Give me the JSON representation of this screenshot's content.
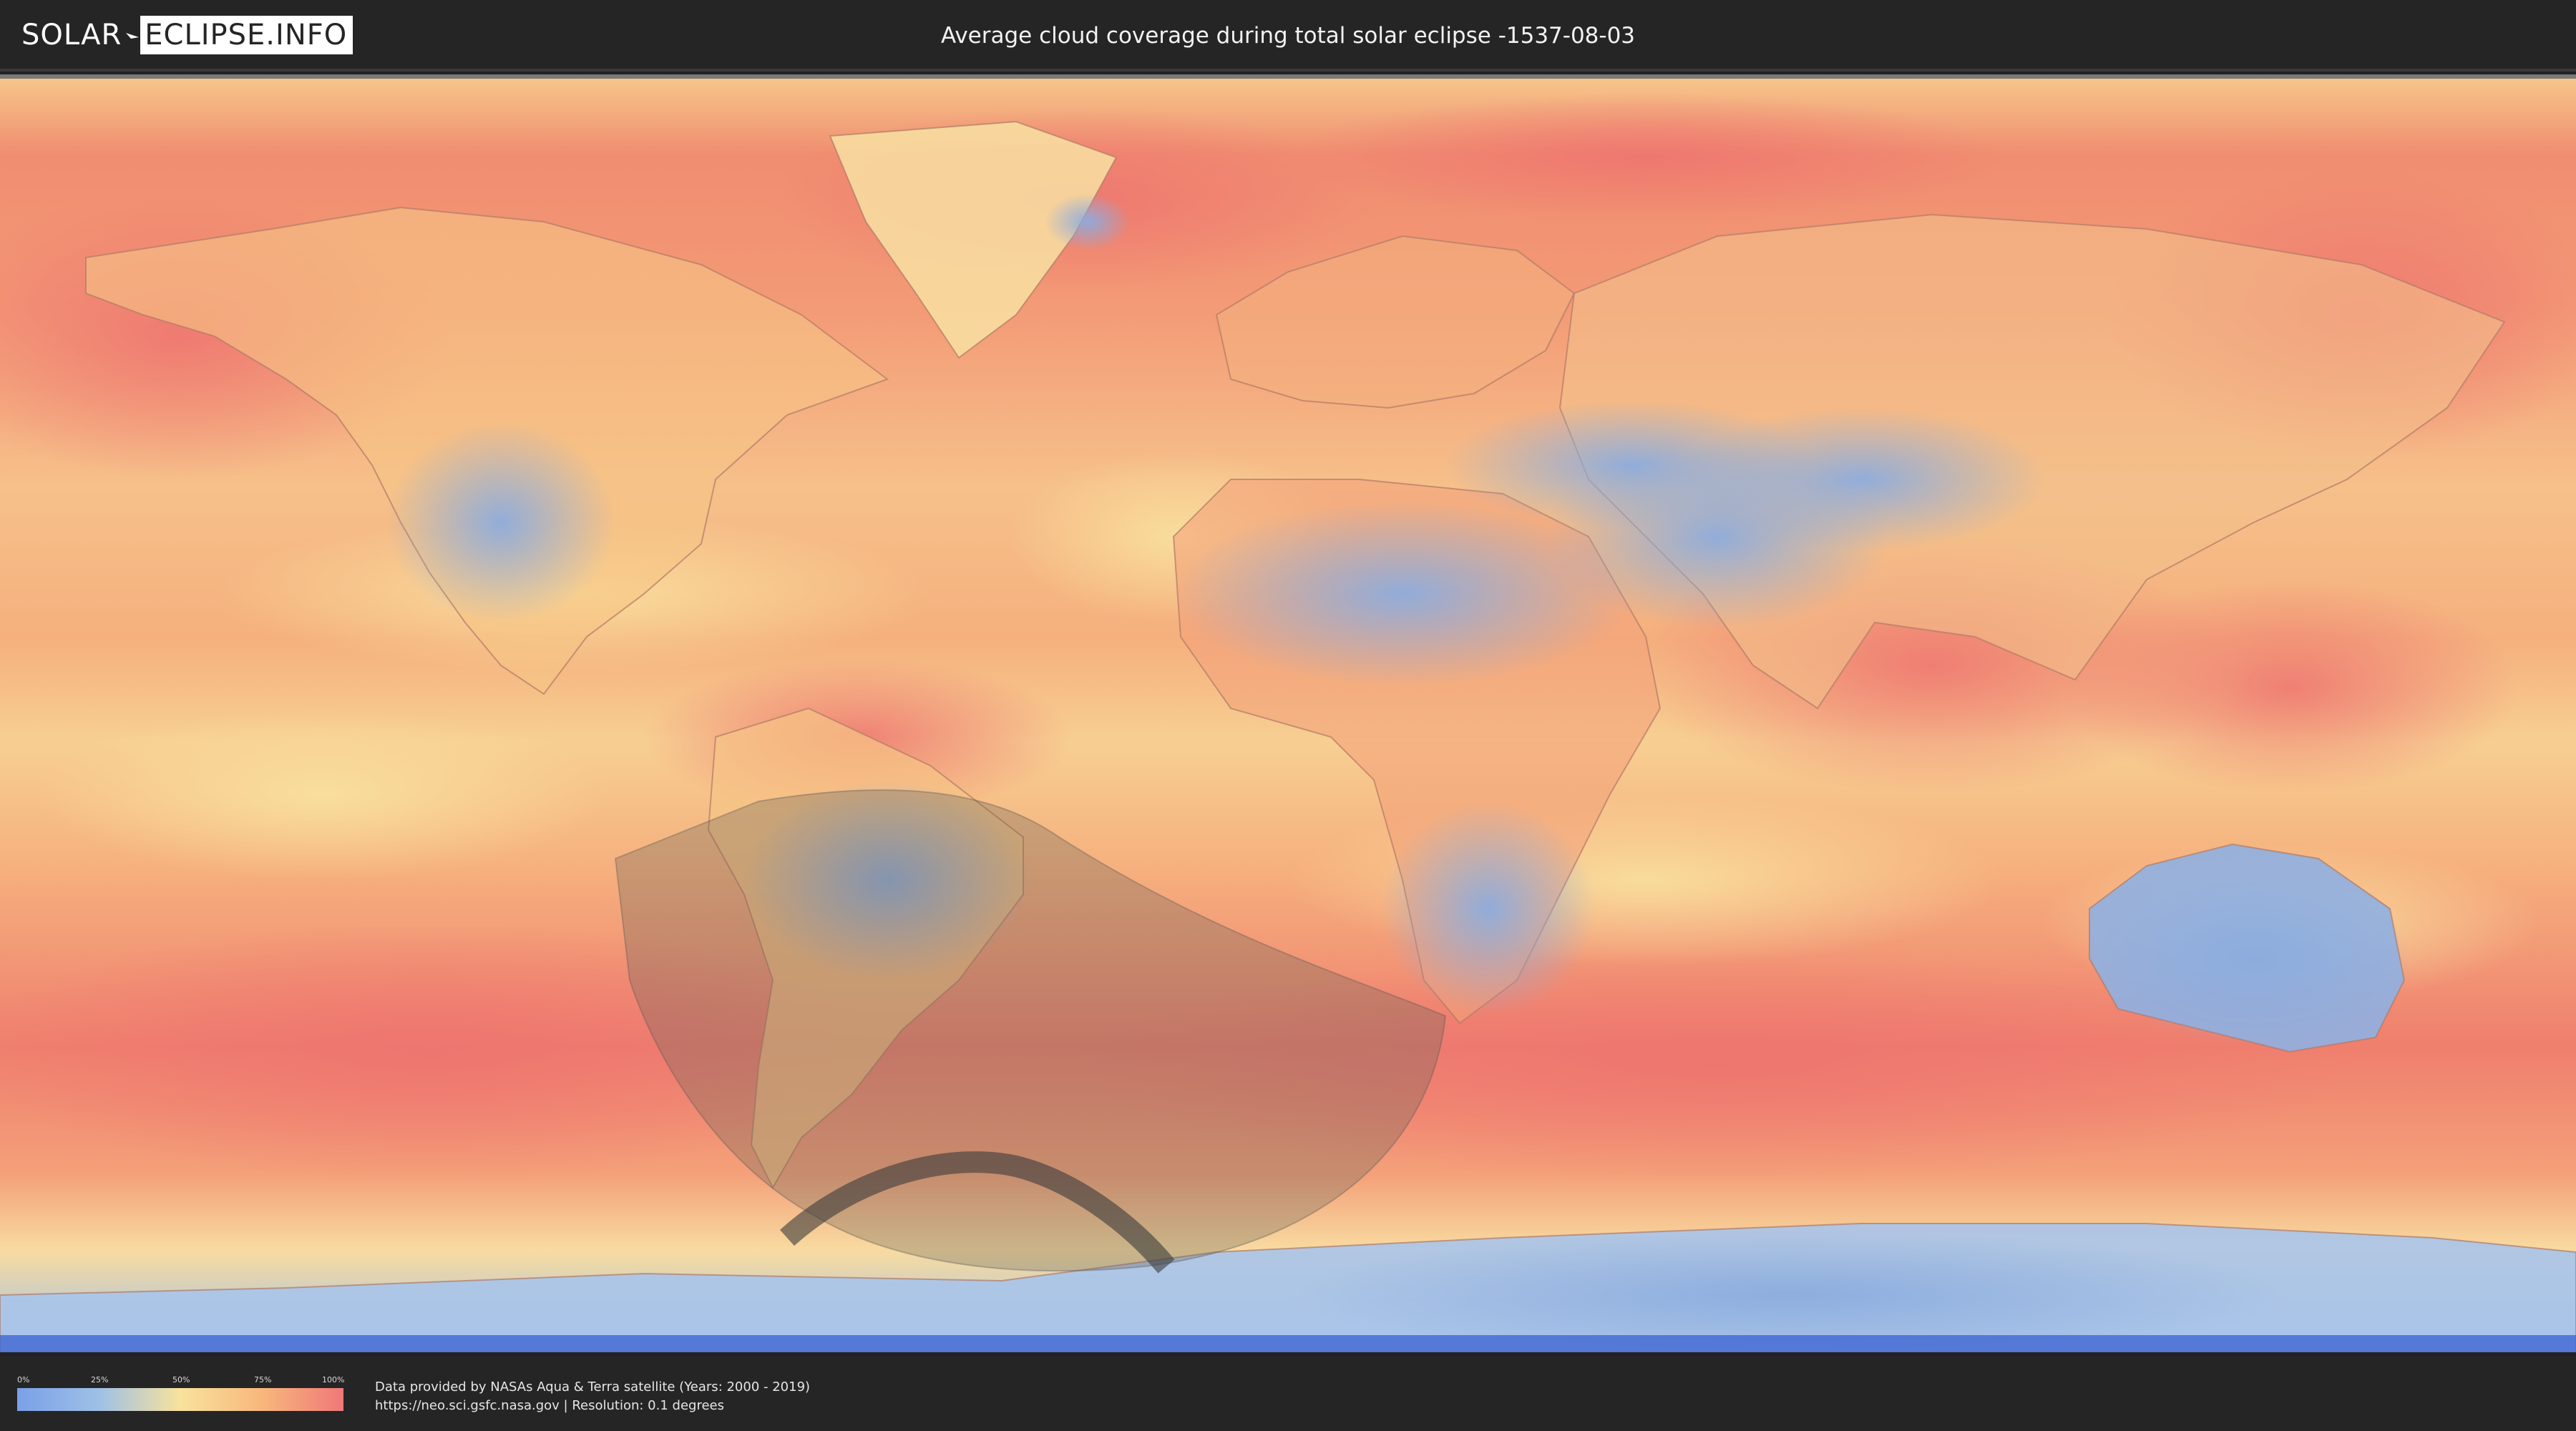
{
  "header": {
    "logo_part1": "SOLAR",
    "logo_part2": "ECLIPSE.INFO",
    "title": "Average cloud coverage during total solar eclipse -1537-08-03"
  },
  "legend": {
    "ticks": [
      "0%",
      "25%",
      "50%",
      "75%",
      "100%"
    ],
    "gradient_colors": [
      "#7aa0e8",
      "#9ec0e6",
      "#f8e29c",
      "#f8b77c",
      "#f07878"
    ]
  },
  "source": {
    "line1": "Data provided by NASAs Aqua & Terra satellite (Years: 2000 - 2019)",
    "line2": "https://neo.sci.gsfc.nasa.gov | Resolution: 0.1 degrees"
  },
  "map": {
    "projection": "equirectangular",
    "eclipse_shadow_color": "#5a5a5a",
    "eclipse_path_color": "#3a3a3a",
    "ocean_cloud_color": "#f08a6e",
    "clear_land_color": "#86a8e0"
  }
}
